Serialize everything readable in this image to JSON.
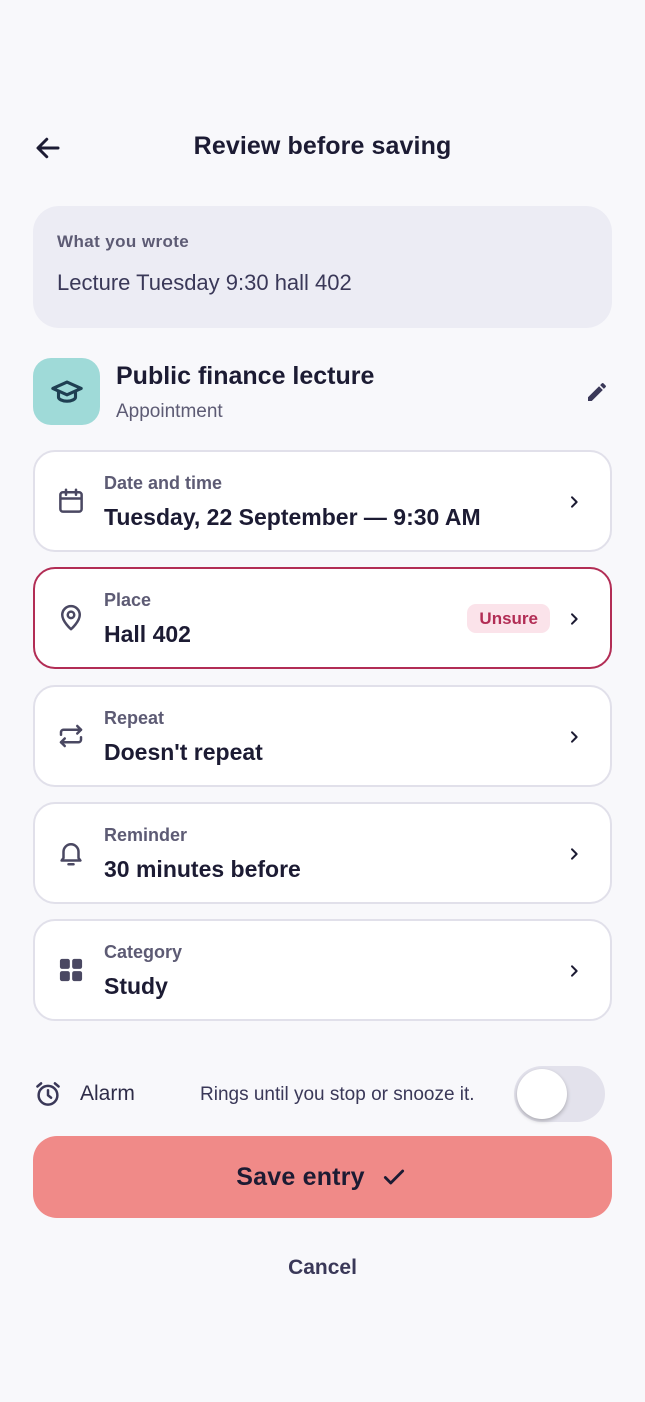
{
  "header": {
    "title": "Review before saving",
    "back_icon": "arrow-left-icon"
  },
  "input_card": {
    "label": "What you wrote",
    "text": "Lecture Tuesday 9:30 hall 402"
  },
  "summary": {
    "title": "Public finance lecture",
    "type": "Appointment",
    "icon": "graduation-cap-icon",
    "icon_bg": "#9fdad8",
    "edit_icon": "pencil-icon"
  },
  "details": [
    {
      "label": "Date and time",
      "value": "Tuesday, 22 September — 9:30 AM",
      "icon": "calendar-icon"
    },
    {
      "label": "Place",
      "value": "Hall 402",
      "icon": "location-pin-icon",
      "badge": "Unsure",
      "warning": true
    },
    {
      "label": "Repeat",
      "value": "Doesn't repeat",
      "icon": "repeat-icon"
    },
    {
      "label": "Reminder",
      "value": "30 minutes before",
      "icon": "bell-icon"
    },
    {
      "label": "Category",
      "value": "Study",
      "icon": "grid-icon"
    }
  ],
  "alarm": {
    "label": "Alarm",
    "description": "Rings until you stop or snooze it.",
    "enabled": false,
    "icon": "alarm-clock-icon"
  },
  "actions": {
    "save_label": "Save entry",
    "cancel_label": "Cancel"
  },
  "colors": {
    "accent": "#f08a88",
    "warning": "#b22d55",
    "background": "#f8f8fb"
  }
}
